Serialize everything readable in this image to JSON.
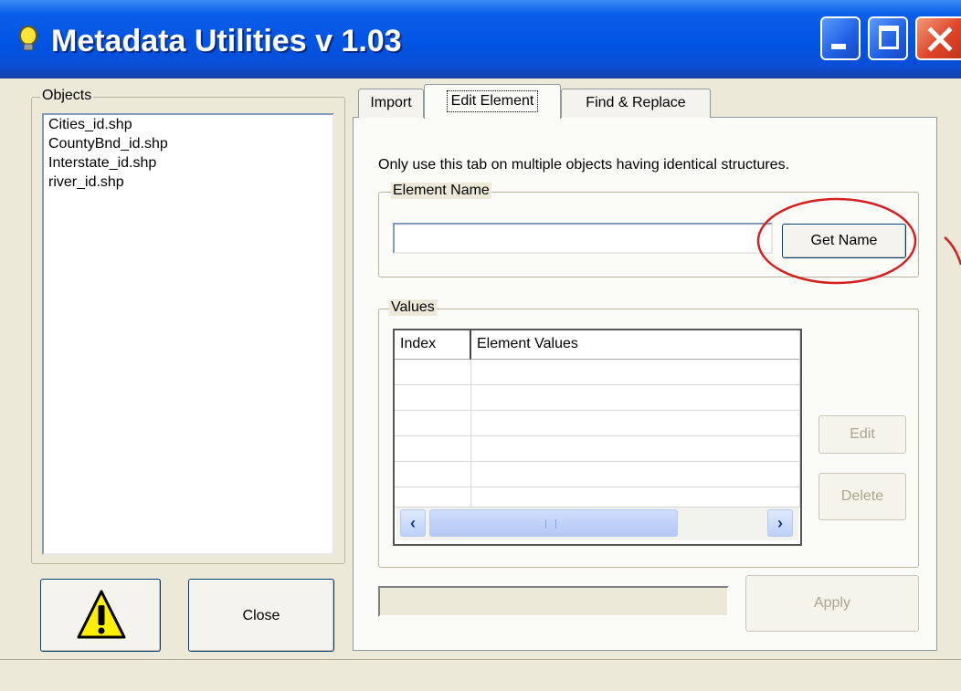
{
  "window": {
    "title": "Metadata Utilities v 1.03"
  },
  "objects": {
    "label": "Objects",
    "items": [
      "Cities_id.shp",
      "CountyBnd_id.shp",
      "Interstate_id.shp",
      "river_id.shp"
    ]
  },
  "tabs": [
    {
      "label": "Import"
    },
    {
      "label": "Edit Element"
    },
    {
      "label": "Find & Replace"
    }
  ],
  "edit_element": {
    "instruction": "Only use this tab on multiple objects having identical structures.",
    "element_name_label": "Element Name",
    "element_name_value": "",
    "get_name_label": "Get Name",
    "values_label": "Values",
    "columns": [
      "Index",
      "Element Values"
    ],
    "edit_label": "Edit",
    "delete_label": "Delete",
    "apply_label": "Apply"
  },
  "footer": {
    "close_label": "Close"
  },
  "colors": {
    "titlebar": "#0054e3",
    "highlight_circle": "#d42020",
    "face": "#ece9d8"
  }
}
